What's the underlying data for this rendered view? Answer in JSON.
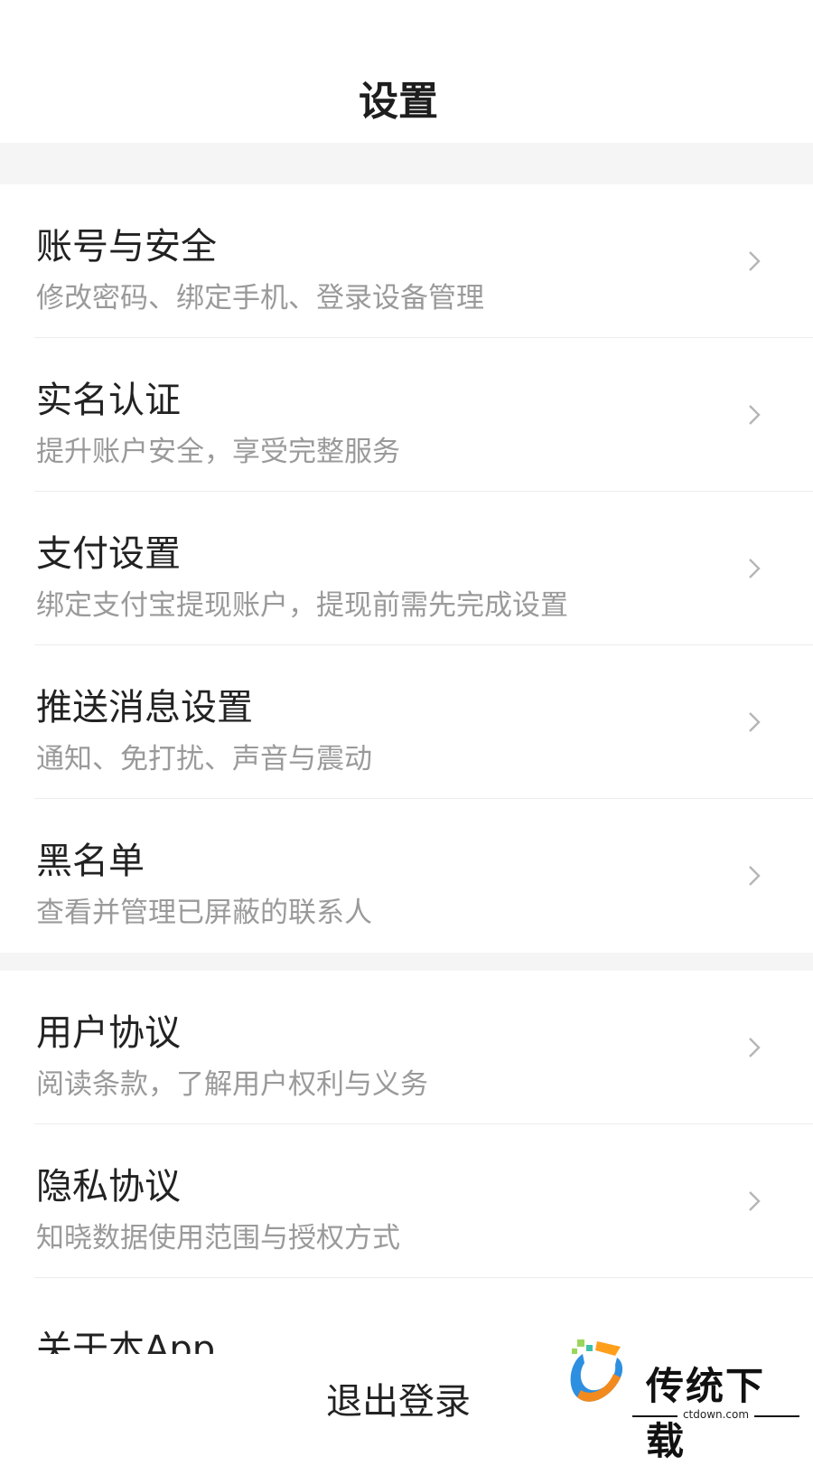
{
  "header": {
    "title": "设置"
  },
  "settings": [
    {
      "title": "账号与安全",
      "subtitle": "修改密码、绑定手机、登录设备管理"
    },
    {
      "title": "实名认证",
      "subtitle": "提升账户安全，享受完整服务"
    },
    {
      "title": "支付设置",
      "subtitle": "绑定支付宝提现账户，提现前需先完成设置"
    },
    {
      "title": "推送消息设置",
      "subtitle": "通知、免打扰、声音与震动"
    },
    {
      "title": "黑名单",
      "subtitle": "查看并管理已屏蔽的联系人"
    },
    {
      "title": "用户协议",
      "subtitle": "阅读条款，了解用户权利与义务"
    },
    {
      "title": "隐私协议",
      "subtitle": "知晓数据使用范围与授权方式"
    },
    {
      "title": "关于本App"
    }
  ],
  "logout_label": "退出登录",
  "watermark": {
    "text": "传统下载",
    "sub": "ctdown.com"
  },
  "colors": {
    "background_gap": "#f5f5f5",
    "subtitle": "#9a9a9a",
    "chevron": "#b5b5b5"
  }
}
